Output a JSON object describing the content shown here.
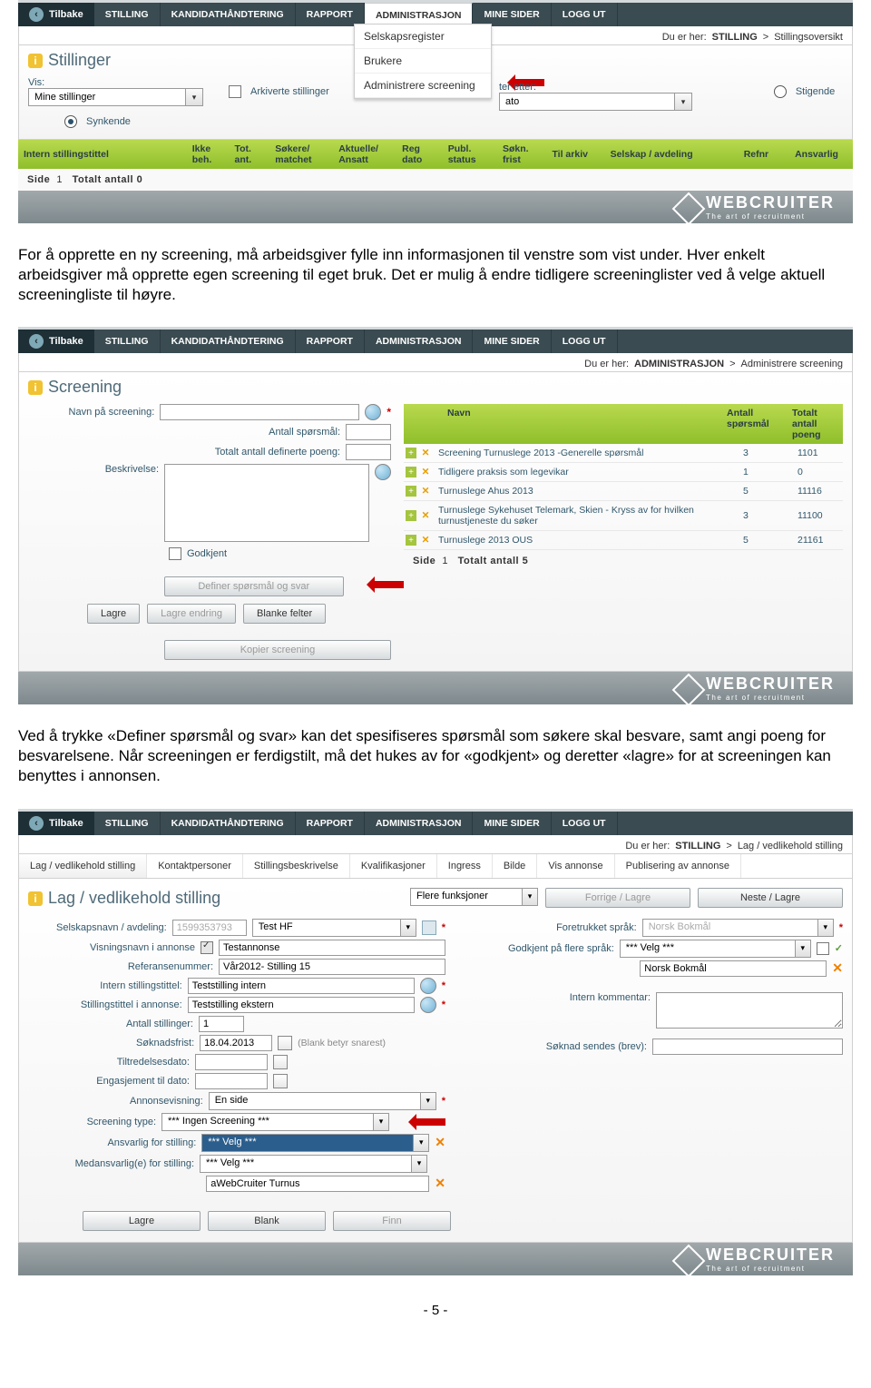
{
  "menu": {
    "back": "Tilbake",
    "items": [
      "STILLING",
      "KANDIDATHÅNDTERING",
      "RAPPORT",
      "ADMINISTRASJON",
      "MINE SIDER",
      "LOGG UT"
    ],
    "active": "ADMINISTRASJON",
    "dropdown": [
      "Selskapsregister",
      "Brukere",
      "Administrere screening"
    ]
  },
  "brand": {
    "name": "WEBCRUITER",
    "tag": "The art of recruitment"
  },
  "s1": {
    "breadcrumbs": [
      "Du er her:",
      "STILLING",
      ">",
      "Stillingsoversikt"
    ],
    "title": "Stillinger",
    "vis": "Vis:",
    "select": "Mine stillinger",
    "archived": "Arkiverte stillinger",
    "filter": "ter etter:",
    "filter_v": "ato",
    "asc": "Stigende",
    "desc": "Synkende",
    "cols": [
      "Intern stillingstittel",
      "Ikke beh.",
      "Tot. ant.",
      "Søkere/ matchet",
      "Aktuelle/ Ansatt",
      "Reg dato",
      "Publ. status",
      "Søkn. frist",
      "Til arkiv",
      "Selskap / avdeling",
      "Refnr",
      "Ansvarlig"
    ],
    "side": "Side",
    "one": "1",
    "total": "Totalt antall 0"
  },
  "p1": "For å opprette en ny screening, må arbeidsgiver fylle inn informasjonen til venstre som vist under. Hver enkelt arbeidsgiver må opprette egen screening til eget bruk. Det er mulig å endre tidligere screeninglister ved å velge aktuell screeningliste til høyre.",
  "s2": {
    "breadcrumbs": [
      "Du er her:",
      "ADMINISTRASJON",
      ">",
      "Administrere screening"
    ],
    "title": "Screening",
    "l1": "Navn på screening:",
    "l2": "Antall spørsmål:",
    "l3": "Totalt antall definerte poeng:",
    "l4": "Beskrivelse:",
    "chk": "Godkjent",
    "b_def": "Definer spørsmål og svar",
    "b_lag": "Lagre",
    "b_le": "Lagre endring",
    "b_bl": "Blanke felter",
    "b_kop": "Kopier screening",
    "cols": [
      "Navn",
      "Antall spørsmål",
      "Totalt antall poeng"
    ],
    "rows": [
      {
        "name": "Screening Turnuslege 2013 -Generelle spørsmål",
        "q": "3",
        "p": "1101"
      },
      {
        "name": "Tidligere praksis som legevikar",
        "q": "1",
        "p": "0"
      },
      {
        "name": "Turnuslege Ahus 2013",
        "q": "5",
        "p": "11116"
      },
      {
        "name": "Turnuslege Sykehuset Telemark, Skien - Kryss av for hvilken turnustjeneste du søker",
        "q": "3",
        "p": "11100"
      },
      {
        "name": "Turnuslege 2013 OUS",
        "q": "5",
        "p": "21161"
      }
    ],
    "side": "Side",
    "one": "1",
    "total": "Totalt antall 5"
  },
  "p2": "Ved å trykke «Definer spørsmål og svar» kan det spesifiseres spørsmål som søkere skal besvare, samt angi poeng for besvarelsene. Når screeningen er ferdigstilt, må det hukes av for «godkjent» og deretter «lagre» for at screeningen kan benyttes i annonsen.",
  "s3": {
    "breadcrumbs": [
      "Du er her:",
      "STILLING",
      ">",
      "Lag / vedlikehold stilling"
    ],
    "tabs": [
      "Lag / vedlikehold stilling",
      "Kontaktpersoner",
      "Stillingsbeskrivelse",
      "Kvalifikasjoner",
      "Ingress",
      "Bilde",
      "Vis annonse",
      "Publisering av annonse"
    ],
    "title": "Lag / vedlikehold stilling",
    "more": "Flere funksjoner",
    "prev": "Forrige / Lagre",
    "next": "Neste / Lagre",
    "left": {
      "l1": "Selskapsnavn / avdeling:",
      "v1": "1599353793",
      "v1b": "Test HF",
      "l2": "Visningsnavn i annonse",
      "v2": "Testannonse",
      "l3": "Referansenummer:",
      "v3": "Vår2012- Stilling 15",
      "l4": "Intern stillingstittel:",
      "v4": "Teststilling intern",
      "l5": "Stillingstittel i annonse:",
      "v5": "Teststilling ekstern",
      "l6": "Antall stillinger:",
      "v6": "1",
      "l7": "Søknadsfrist:",
      "v7": "18.04.2013",
      "hint": "(Blank betyr snarest)",
      "l8": "Tiltredelsesdato:",
      "l9": "Engasjement til dato:",
      "l10": "Annonsevisning:",
      "v10": "En side",
      "l11": "Screening type:",
      "v11": "*** Ingen Screening ***",
      "l12": "Ansvarlig for stilling:",
      "v12": "*** Velg ***",
      "l13": "Medansvarlig(e) for stilling:",
      "v13": "*** Velg ***",
      "v13b": "aWebCruiter Turnus"
    },
    "right": {
      "l1": "Foretrukket språk:",
      "v1": "Norsk Bokmål",
      "l2": "Godkjent på flere språk:",
      "v2": "*** Velg ***",
      "box": "Norsk Bokmål",
      "l3": "Intern kommentar:",
      "l4": "Søknad sendes (brev):"
    },
    "b_lag": "Lagre",
    "b_bl": "Blank",
    "b_fn": "Finn"
  },
  "pgnum": "- 5 -"
}
